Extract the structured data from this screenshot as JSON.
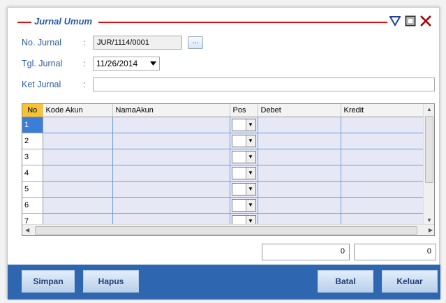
{
  "window": {
    "title": "Jurnal Umum"
  },
  "form": {
    "no_jurnal_label": "No. Jurnal",
    "no_jurnal_value": "JUR/1114/0001",
    "browse_label": "...",
    "tgl_jurnal_label": "Tgl. Jurnal",
    "tgl_jurnal_value": "11/26/2014",
    "ket_jurnal_label": "Ket Jurnal",
    "ket_jurnal_value": "",
    "colon": ":"
  },
  "grid": {
    "columns": [
      "No",
      "Kode Akun",
      "NamaAkun",
      "Pos",
      "Debet",
      "Kredit"
    ],
    "rows": [
      "1",
      "2",
      "3",
      "4",
      "5",
      "6",
      "7"
    ],
    "selected_row": "1"
  },
  "totals": {
    "debet": "0",
    "kredit": "0"
  },
  "buttons": {
    "simpan": "Simpan",
    "hapus": "Hapus",
    "batal": "Batal",
    "keluar": "Keluar"
  },
  "colors": {
    "title_line": "#e01010",
    "footer": "#2f66b0",
    "header_no": "#f7c233",
    "row_selected": "#3b7ed8"
  }
}
